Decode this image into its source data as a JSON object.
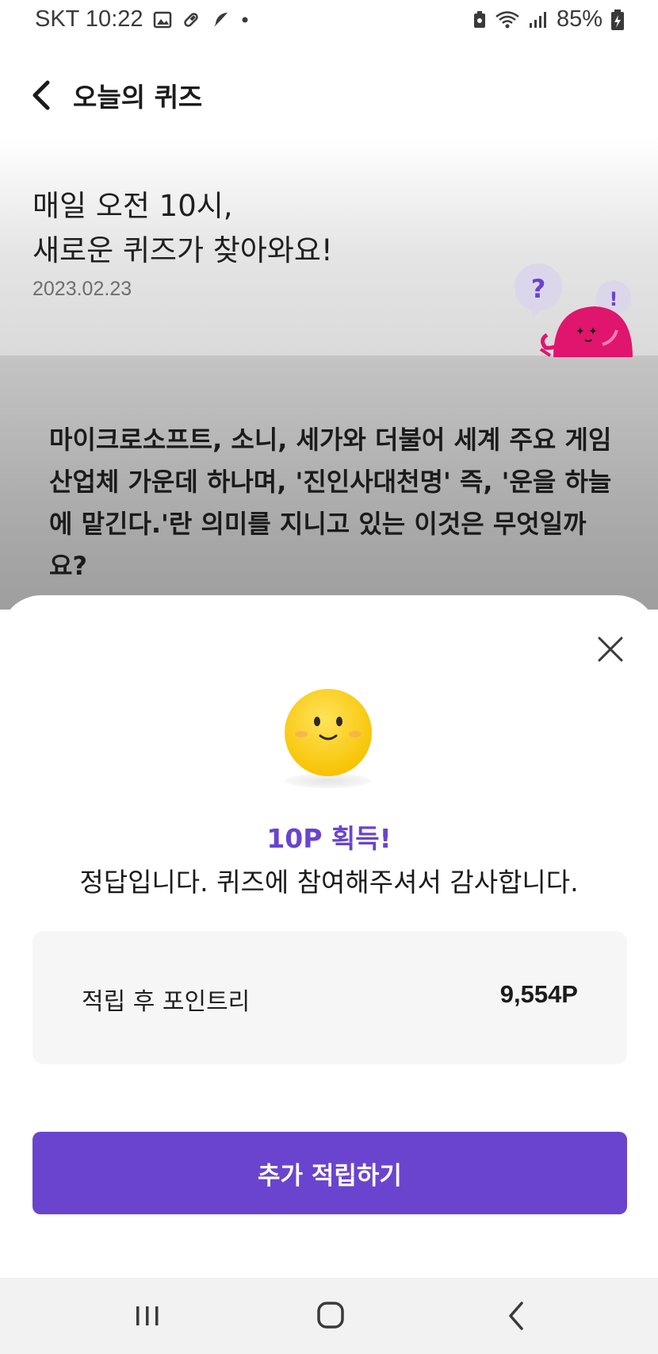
{
  "status_bar": {
    "carrier_time": "SKT 10:22",
    "battery": "85%",
    "icons": [
      "image-icon",
      "pill-icon",
      "feather-icon",
      "dot-icon",
      "battery-saver-icon",
      "wifi-icon",
      "signal-icon",
      "battery-charging-icon"
    ]
  },
  "header": {
    "title": "오늘의 퀴즈",
    "back_icon": "chevron-left-icon"
  },
  "intro": {
    "line1": "매일 오전 10시,",
    "line2": "새로운 퀴즈가 찾아와요!",
    "date": "2023.02.23"
  },
  "mascot": {
    "bubble_question": "?",
    "bubble_exclaim": "!",
    "color": "#e0156e"
  },
  "question": {
    "text": "마이크로소프트, 소니, 세가와 더불어 세계 주요 게임 산업체 가운데 하나며, '진인사대천명' 즉, '운을 하늘에 맡긴다.'란 의미를 지니고 있는 이것은 무엇일까요?"
  },
  "result_sheet": {
    "close_icon": "close-icon",
    "reward_title": "10P 획득!",
    "message": "정답입니다. 퀴즈에 참여해주셔서 감사합니다.",
    "points_label": "적립 후 포인트리",
    "points_value": "9,554P",
    "button_label": "추가 적립하기"
  },
  "colors": {
    "accent": "#6a44cf",
    "card_bg": "#f6f6f6"
  },
  "nav_bar": {
    "icons": [
      "recent-apps-icon",
      "home-icon",
      "back-icon"
    ]
  }
}
